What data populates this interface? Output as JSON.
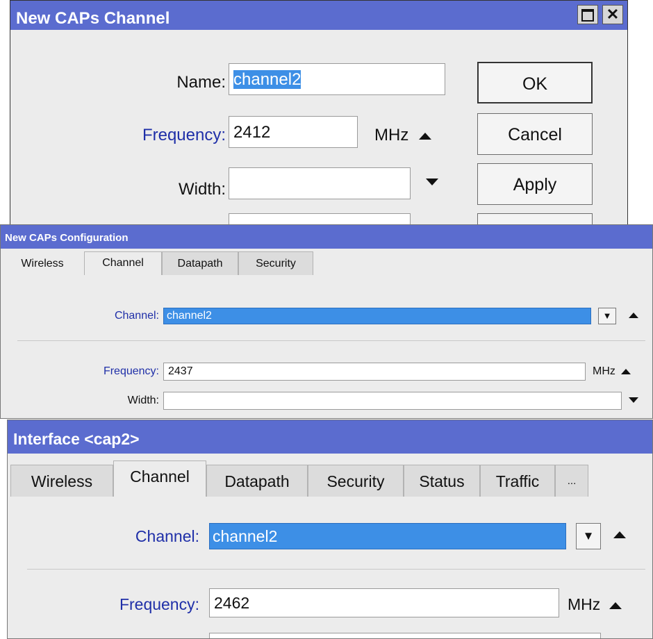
{
  "w1": {
    "title": "New CAPs Channel",
    "name_label": "Name:",
    "name_value": "channel2",
    "freq_label": "Frequency:",
    "freq_value": "2412",
    "freq_unit": "MHz",
    "width_label": "Width:",
    "ok": "OK",
    "cancel": "Cancel",
    "apply": "Apply"
  },
  "w2": {
    "title": "New CAPs Configuration",
    "tabs": [
      "Wireless",
      "Channel",
      "Datapath",
      "Security"
    ],
    "channel_label": "Channel:",
    "channel_value": "channel2",
    "freq_label": "Frequency:",
    "freq_value": "2437",
    "freq_unit": "MHz",
    "width_label": "Width:"
  },
  "w3": {
    "title": "Interface <cap2>",
    "tabs": [
      "Wireless",
      "Channel",
      "Datapath",
      "Security",
      "Status",
      "Traffic",
      "..."
    ],
    "channel_label": "Channel:",
    "channel_value": "channel2",
    "freq_label": "Frequency:",
    "freq_value": "2462",
    "freq_unit": "MHz"
  },
  "colors": {
    "titlebar": "#5b6ccf",
    "label_blue": "#1f2fa8",
    "selection": "#3d8fe6"
  }
}
